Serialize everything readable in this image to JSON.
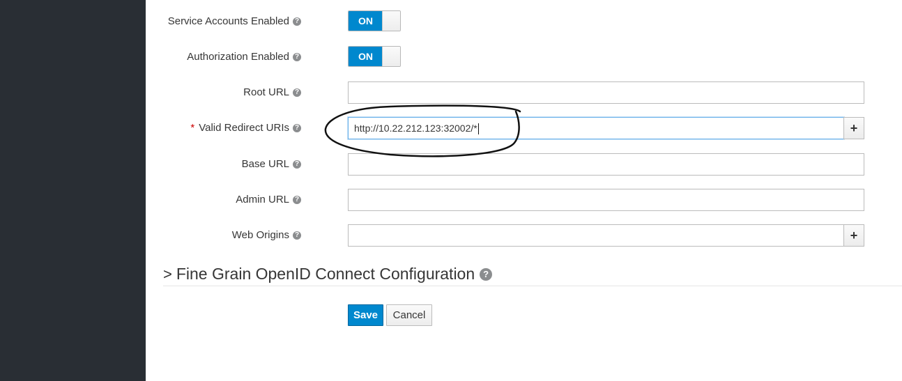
{
  "fields": {
    "service_accounts": {
      "label": "Service Accounts Enabled",
      "toggle": "ON"
    },
    "authorization": {
      "label": "Authorization Enabled",
      "toggle": "ON"
    },
    "root_url": {
      "label": "Root URL",
      "value": ""
    },
    "valid_redirect": {
      "required_mark": "*",
      "label": "Valid Redirect URIs",
      "value": "http://10.22.212.123:32002/*"
    },
    "base_url": {
      "label": "Base URL",
      "value": ""
    },
    "admin_url": {
      "label": "Admin URL",
      "value": ""
    },
    "web_origins": {
      "label": "Web Origins",
      "value": ""
    }
  },
  "section": {
    "chevron": ">",
    "title": "Fine Grain OpenID Connect Configuration"
  },
  "buttons": {
    "save": "Save",
    "cancel": "Cancel",
    "add": "+"
  },
  "icons": {
    "help": "question-circle-icon",
    "add": "plus-icon",
    "chevron": "chevron-right-icon"
  },
  "colors": {
    "sidebar": "#292e34",
    "primary": "#0088ce",
    "required": "#cc0000"
  }
}
